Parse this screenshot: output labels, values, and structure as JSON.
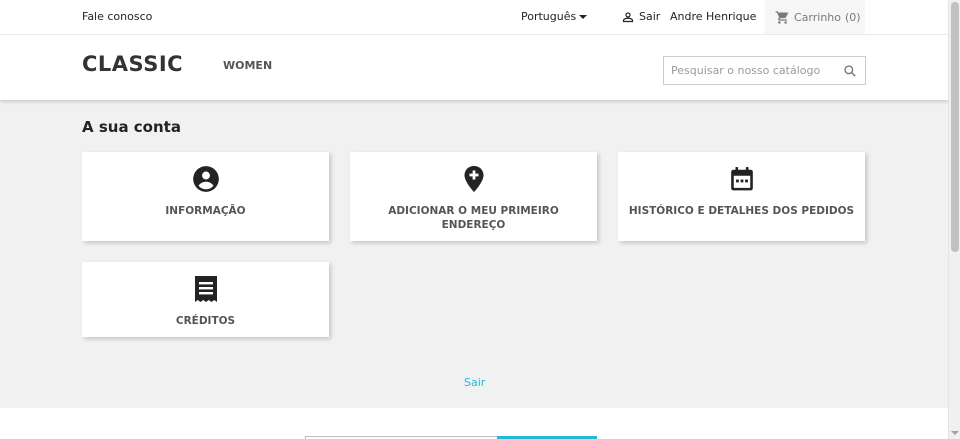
{
  "topnav": {
    "contact_label": "Fale conosco",
    "language": "Português",
    "signout_label": "Sair",
    "username": "Andre Henrique",
    "cart_label": "Carrinho",
    "cart_count": "(0)"
  },
  "header": {
    "logo": "CLASSIC",
    "menu": [
      "WOMEN"
    ],
    "search_placeholder": "Pesquisar o nosso catálogo"
  },
  "account": {
    "title": "A sua conta",
    "cards": [
      {
        "label": "INFORMAÇÃO",
        "icon": "account-circle-icon"
      },
      {
        "label": "ADICIONAR O MEU PRIMEIRO ENDEREÇO",
        "icon": "add-location-icon"
      },
      {
        "label": "HISTÓRICO E DETALHES DOS PEDIDOS",
        "icon": "calendar-icon"
      },
      {
        "label": "CRÉDITOS",
        "icon": "receipt-icon"
      }
    ],
    "logout_label": "Sair"
  },
  "colors": {
    "accent": "#24b9d7",
    "background": "#f1f1f1",
    "text": "#232323"
  }
}
